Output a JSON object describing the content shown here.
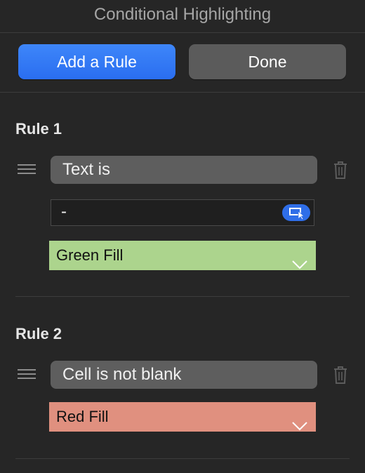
{
  "panel": {
    "title": "Conditional Highlighting"
  },
  "toolbar": {
    "add_rule_label": "Add a Rule",
    "done_label": "Done"
  },
  "rules": [
    {
      "heading": "Rule 1",
      "condition": "Text is",
      "value": "-",
      "style": "Green Fill",
      "style_color": "#acd48d"
    },
    {
      "heading": "Rule 2",
      "condition": "Cell is not blank",
      "style": "Red Fill",
      "style_color": "#e0907f"
    }
  ],
  "colors": {
    "background": "#262626",
    "accent": "#2f6ee8",
    "button_secondary": "#5b5b5b"
  },
  "icons": {
    "drag_handle": "drag-handle-icon",
    "trash": "trash-icon",
    "cell_reference": "cell-reference-icon",
    "chevron_down": "chevron-down-icon"
  }
}
